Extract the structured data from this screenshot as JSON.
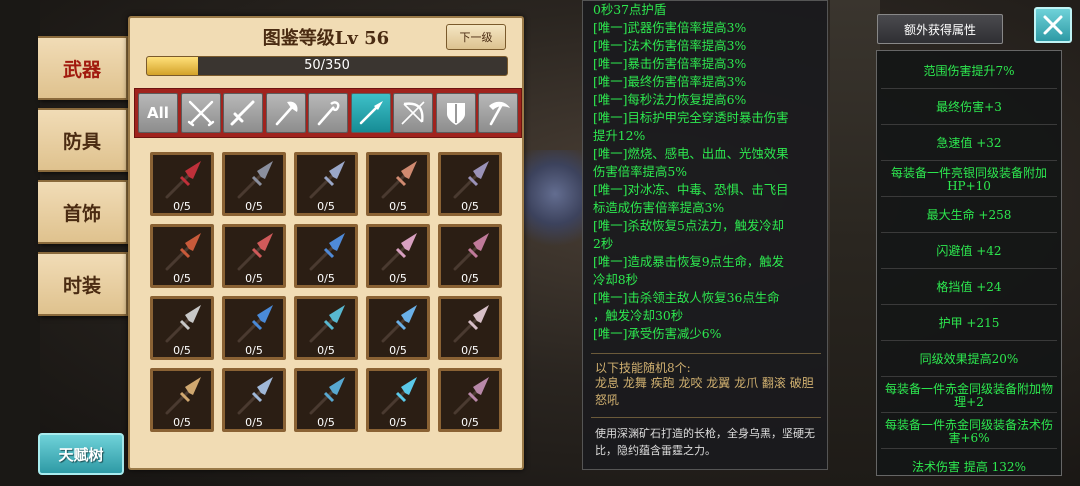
{
  "side_tabs": [
    {
      "label": "武器",
      "active": true
    },
    {
      "label": "防具",
      "active": false
    },
    {
      "label": "首饰",
      "active": false
    },
    {
      "label": "时装",
      "active": false
    }
  ],
  "talent_button": "天赋树",
  "panel": {
    "title": "图鉴等级Lv 56",
    "next_button": "下一级",
    "progress_text": "50/350",
    "progress_fraction": 0.143
  },
  "filters": [
    {
      "name": "all",
      "label": "All",
      "icon": "all",
      "active": false
    },
    {
      "name": "dual-blades",
      "icon": "dual-blades-icon",
      "active": false
    },
    {
      "name": "sword",
      "icon": "sword-icon",
      "active": false
    },
    {
      "name": "axe",
      "icon": "axe-icon",
      "active": false
    },
    {
      "name": "staff",
      "icon": "staff-icon",
      "active": false
    },
    {
      "name": "spear",
      "icon": "spear-icon",
      "active": true
    },
    {
      "name": "bow",
      "icon": "bow-icon",
      "active": false
    },
    {
      "name": "shield",
      "icon": "shield-icon",
      "active": false
    },
    {
      "name": "scythe",
      "icon": "scythe-icon",
      "active": false
    }
  ],
  "weapon_slots": [
    {
      "count": "0/5",
      "color": "#c0303a"
    },
    {
      "count": "0/5",
      "color": "#8a8f9e"
    },
    {
      "count": "0/5",
      "color": "#9aa7c8"
    },
    {
      "count": "0/5",
      "color": "#d08a70"
    },
    {
      "count": "0/5",
      "color": "#9a92b8"
    },
    {
      "count": "0/5",
      "color": "#c85a3a"
    },
    {
      "count": "0/5",
      "color": "#d05a5a"
    },
    {
      "count": "0/5",
      "color": "#4f8ad8"
    },
    {
      "count": "0/5",
      "color": "#d8a0c0"
    },
    {
      "count": "0/5",
      "color": "#c07a9a"
    },
    {
      "count": "0/5",
      "color": "#c8c8c8"
    },
    {
      "count": "0/5",
      "color": "#4a8ad8"
    },
    {
      "count": "0/5",
      "color": "#58b8d0"
    },
    {
      "count": "0/5",
      "color": "#6ab0e8"
    },
    {
      "count": "0/5",
      "color": "#d8c0c8"
    },
    {
      "count": "0/5",
      "color": "#d0a870"
    },
    {
      "count": "0/5",
      "color": "#a0b8d8"
    },
    {
      "count": "0/5",
      "color": "#58a8d0"
    },
    {
      "count": "0/5",
      "color": "#5ac8e8"
    },
    {
      "count": "0/5",
      "color": "#b888a8"
    }
  ],
  "description": {
    "lines": [
      "0秒37点护盾",
      "[唯一]武器伤害倍率提高3%",
      "[唯一]法术伤害倍率提高3%",
      "[唯一]暴击伤害倍率提高3%",
      "[唯一]最终伤害倍率提高3%",
      "[唯一]每秒法力恢复提高6%",
      "[唯一]目标护甲完全穿透时暴击伤害",
      "提升12%",
      "[唯一]燃烧、感电、出血、光蚀效果",
      "伤害倍率提高5%",
      "[唯一]对冰冻、中毒、恐惧、击飞目",
      "标造成伤害倍率提高3%",
      "[唯一]杀敌恢复5点法力，触发冷却",
      "2秒",
      "[唯一]造成暴击恢复9点生命，触发",
      "冷却8秒",
      "[唯一]击杀领主敌人恢复36点生命",
      "，触发冷却30秒",
      "[唯一]承受伤害减少6%"
    ],
    "skills_title": "以下技能随机8个:",
    "skills": "龙息 龙舞 疾跑 龙咬 龙翼 龙爪 翻滚 破胆怒吼",
    "flavor": "使用深渊矿石打造的长枪，全身乌黑，坚硬无比，隐约蕴含雷霆之力。"
  },
  "attributes": {
    "header": "额外获得属性",
    "items": [
      "范围伤害提升7%",
      "最终伤害+3",
      "急速值 +32",
      "每装备一件亮银同级装备附加HP+10",
      "最大生命 +258",
      "闪避值 +42",
      "格挡值 +24",
      "护甲 +215",
      "同级效果提高20%",
      "每装备一件赤金同级装备附加物理+2",
      "每装备一件赤金同级装备法术伤害+6%",
      "法术伤害 提高 132%"
    ]
  }
}
